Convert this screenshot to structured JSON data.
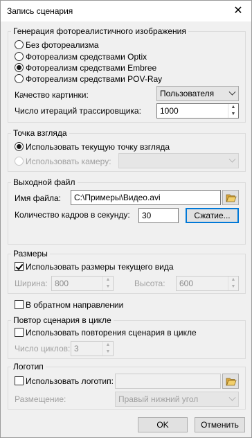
{
  "window": {
    "title": "Запись сценария",
    "close_glyph": "✕"
  },
  "generation": {
    "legend": "Генерация фотореалистичного изображения",
    "options": [
      {
        "label": "Без фотореализма",
        "selected": false
      },
      {
        "label": "Фотореализм средствами Optix",
        "selected": false
      },
      {
        "label": "Фотореализм средствами Embree",
        "selected": true
      },
      {
        "label": "Фотореализм средствами POV-Ray",
        "selected": false
      }
    ],
    "quality_label": "Качество картинки:",
    "quality_value": "Пользователя",
    "iterations_label": "Число итераций трассировщика:",
    "iterations_value": "1000"
  },
  "viewpoint": {
    "legend": "Точка взгляда",
    "use_current": "Использовать текущую точку взгляда",
    "use_camera": "Использовать камеру:",
    "camera_value": ""
  },
  "output": {
    "legend": "Выходной файл",
    "filename_label": "Имя файла:",
    "filename_value": "C:\\Примеры\\Видео.avi",
    "fps_label": "Количество кадров в секунду:",
    "fps_value": "30",
    "compress_button": "Сжатие..."
  },
  "sizes": {
    "legend": "Размеры",
    "use_view_size": "Использовать размеры текущего вида",
    "width_label": "Ширина:",
    "width_value": "800",
    "height_label": "Высота:",
    "height_value": "600"
  },
  "reverse": {
    "label": "В обратном направлении",
    "checked": false
  },
  "loop": {
    "legend": "Повтор сценария в цикле",
    "use_loop": "Использовать повторения сценария в цикле",
    "cycles_label": "Число циклов:",
    "cycles_value": "3"
  },
  "logo": {
    "legend": "Логотип",
    "use_logo": "Использовать логотип:",
    "logo_value": "",
    "placement_label": "Размещение:",
    "placement_value": "Правый нижний угол"
  },
  "footer": {
    "ok": "OK",
    "cancel": "Отменить"
  },
  "icons": {
    "folder": "folder-open-icon",
    "dropdown": "chevron-down-icon",
    "spin": "spin-arrows-icon"
  },
  "colors": {
    "accent": "#0078d7",
    "folder": "#e8c25a"
  }
}
